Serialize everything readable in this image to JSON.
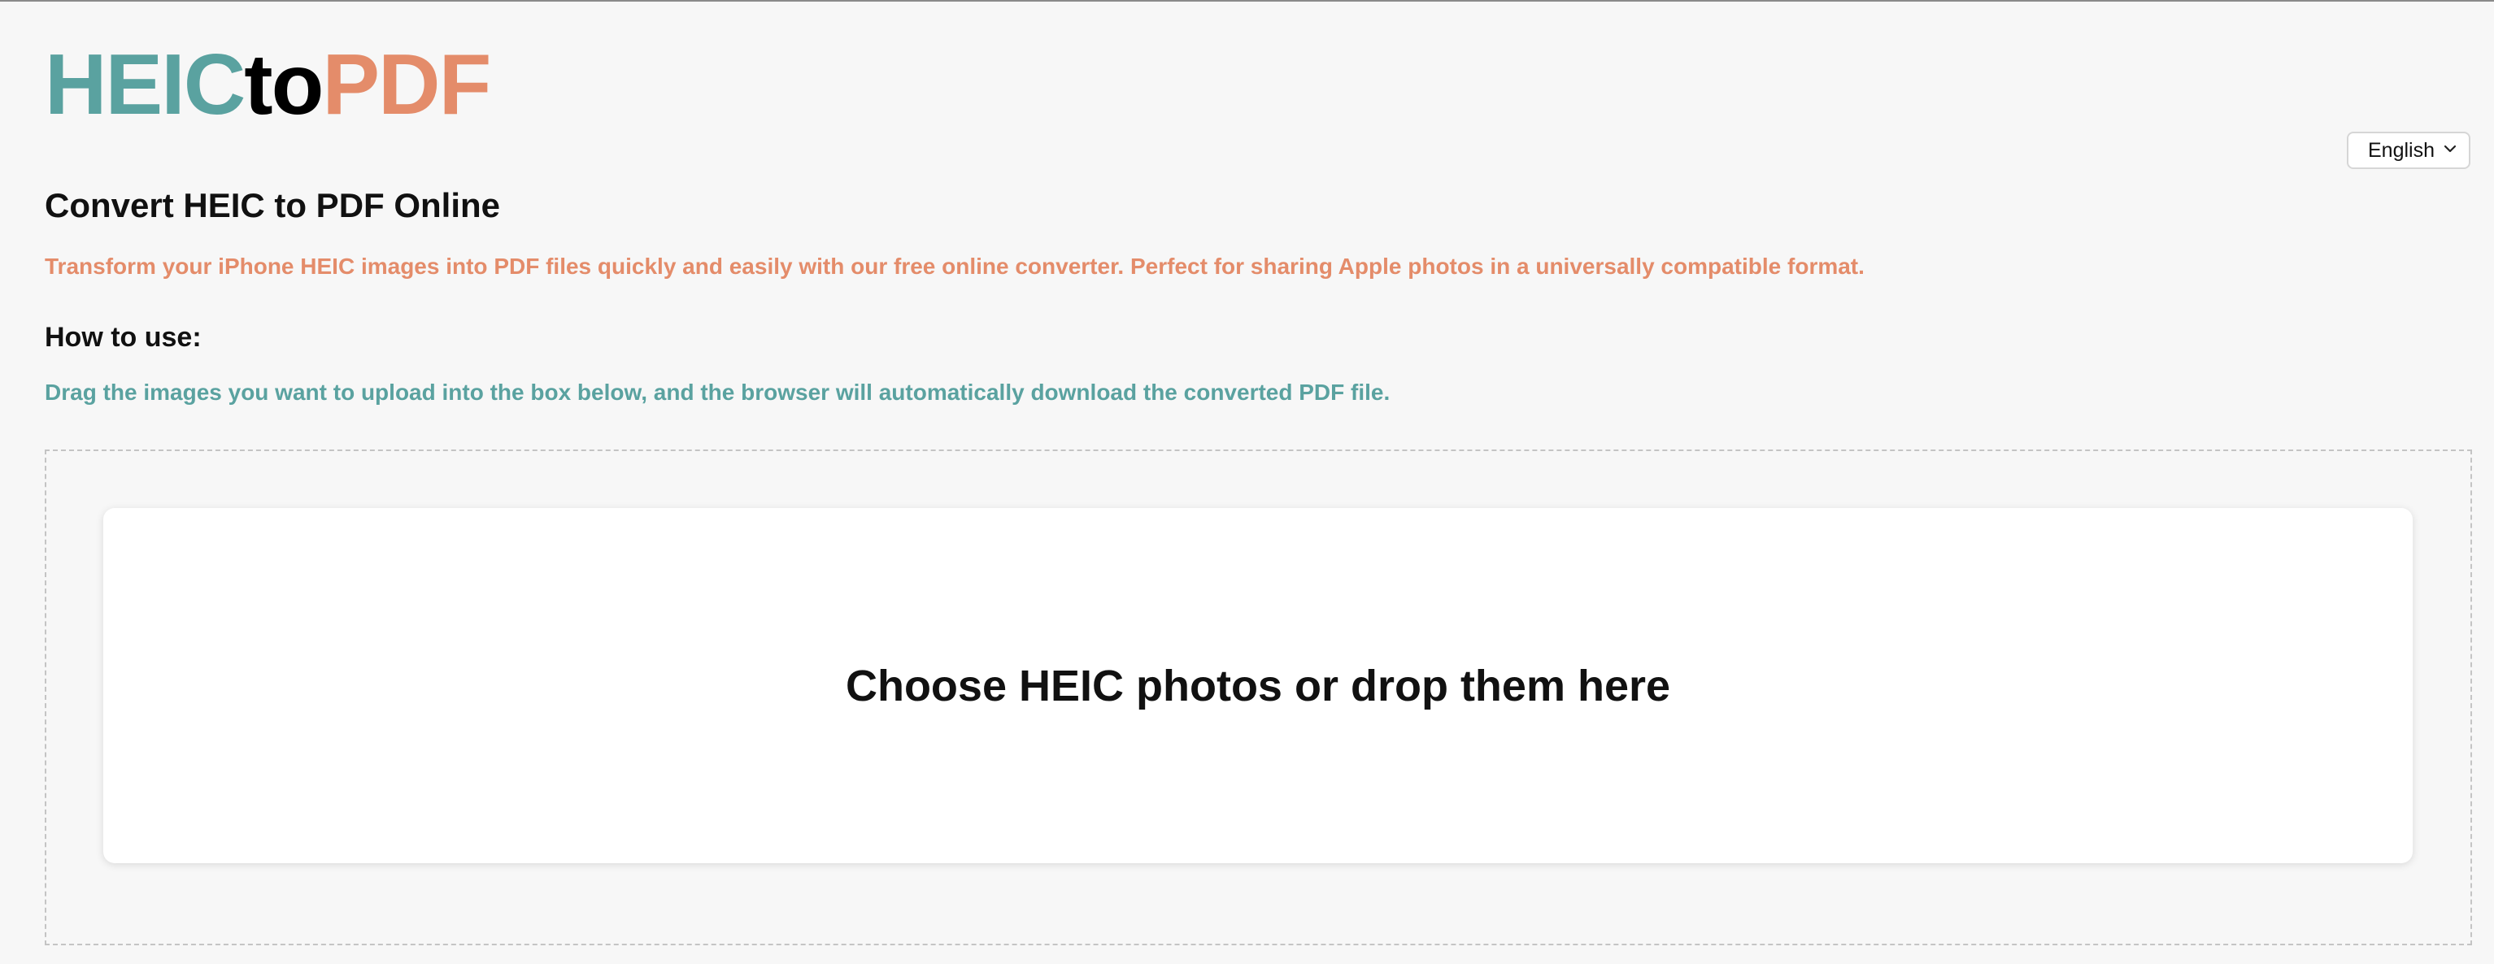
{
  "logo": {
    "part1": "HEIC",
    "part2": "to",
    "part3": "PDF",
    "colors": {
      "part1": "#5aa2a0",
      "part2": "#000000",
      "part3": "#e48c6a"
    }
  },
  "language": {
    "selected": "English",
    "icon": "chevron-down-icon"
  },
  "main": {
    "title": "Convert HEIC to PDF Online",
    "subtitle": "Transform your iPhone HEIC images into PDF files quickly and easily with our free online converter. Perfect for sharing Apple photos in a universally compatible format.",
    "howto_heading": "How to use:",
    "instructions": "Drag the images you want to upload into the box below, and the browser will automatically download the converted PDF file."
  },
  "upload": {
    "label": "Choose HEIC photos or drop them here"
  },
  "colors": {
    "background": "#f7f7f7",
    "accent_teal": "#5aa2a0",
    "accent_orange": "#e48c6a",
    "text": "#111111"
  }
}
